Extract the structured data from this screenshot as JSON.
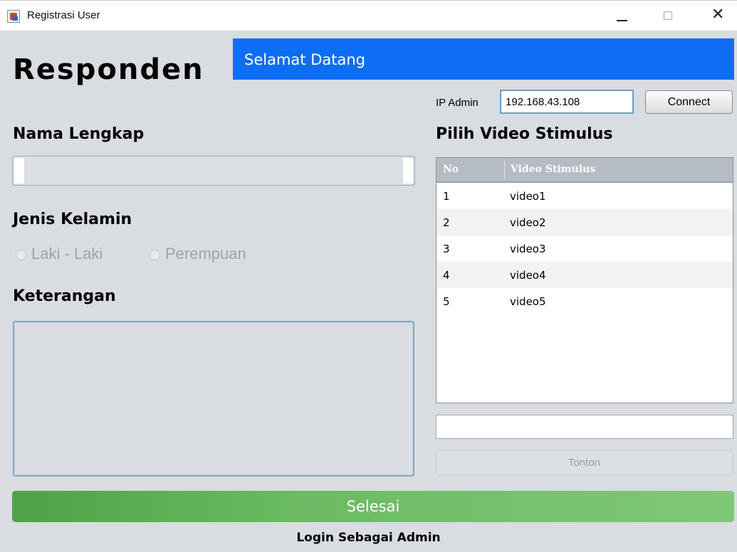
{
  "window": {
    "title": "Registrasi User",
    "minimize_glyph": "—",
    "maximize_glyph": "☐",
    "close_glyph": "✕"
  },
  "header": {
    "heading": "Responden",
    "welcome": "Selamat Datang",
    "banner_color": "#0d6ef5"
  },
  "connection": {
    "ip_label": "IP Admin",
    "ip_value": "192.168.43.108",
    "connect_label": "Connect"
  },
  "form": {
    "name_label": "Nama Lengkap",
    "name_value": "",
    "gender_label": "Jenis Kelamin",
    "gender_options": [
      "Laki - Laki",
      "Perempuan"
    ],
    "notes_label": "Keterangan",
    "notes_value": ""
  },
  "videos": {
    "heading": "Pilih Video Stimulus",
    "columns": [
      "No",
      "Video Stimulus"
    ],
    "rows": [
      {
        "no": "1",
        "name": "video1"
      },
      {
        "no": "2",
        "name": "video2"
      },
      {
        "no": "3",
        "name": "video3"
      },
      {
        "no": "4",
        "name": "video4"
      },
      {
        "no": "5",
        "name": "video5"
      }
    ],
    "selected_value": "",
    "watch_label": "Tonton"
  },
  "footer": {
    "finish_label": "Selesai",
    "finish_color": "#6cbb63",
    "admin_login_label": "Login Sebagai Admin"
  }
}
